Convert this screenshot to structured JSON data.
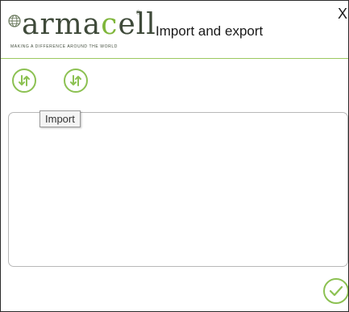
{
  "header": {
    "logo_prefix": "arma",
    "logo_accent": "c",
    "logo_suffix": "ell",
    "logo_tagline": "MAKING A DIFFERENCE AROUND THE WORLD",
    "title": "Import and export",
    "close_label": "X"
  },
  "toolbar": {
    "buttons": [
      {
        "icon": "import-export-icon"
      },
      {
        "icon": "import-export-icon"
      }
    ],
    "tooltip": "Import"
  },
  "footer": {
    "confirm_icon": "checkmark-icon"
  },
  "colors": {
    "accent": "#8cc152",
    "logo_text": "#3f4a3a",
    "border": "#b8b8b8"
  }
}
